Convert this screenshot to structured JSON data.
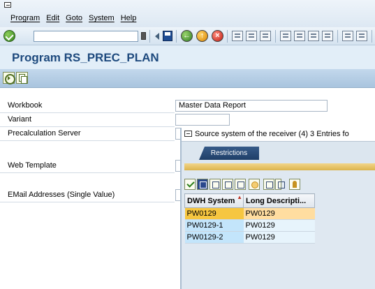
{
  "menu": [
    "Program",
    "Edit",
    "Goto",
    "System",
    "Help"
  ],
  "toolbar": {
    "command_field_value": "",
    "icons": [
      "enter-icon",
      "back-icon",
      "save-icon",
      "back-circle-icon",
      "exit-icon",
      "cancel-icon",
      "print-icon",
      "find-icon",
      "find-next-icon",
      "first-page-icon",
      "previous-page-icon",
      "next-page-icon",
      "last-page-icon"
    ]
  },
  "title": "Program RS_PREC_PLAN",
  "app_toolbar": {
    "icons": [
      "execute-icon",
      "get-variant-icon"
    ]
  },
  "form": {
    "fields": [
      {
        "label": "Workbook",
        "value": "Master Data Report"
      },
      {
        "label": "Variant",
        "value": ""
      },
      {
        "label": "Precalculation Server",
        "value": ""
      },
      {
        "label": "Web Template",
        "value": ""
      },
      {
        "label": "EMail Addresses (Single Value)",
        "value": ""
      }
    ]
  },
  "popup": {
    "title": "Source system of the receiver (4)   3 Entries fo",
    "tab": "Restrictions",
    "toolbar_icons": [
      "accept-icon",
      "cancel-icon",
      "find-icon",
      "find-next-icon",
      "filter-icon",
      "info-icon",
      "print-icon",
      "dropdown-icon",
      "personal-list-icon"
    ],
    "columns": [
      "DWH System",
      "Long Descripti..."
    ],
    "rows": [
      {
        "system": "PW0129",
        "description": "PW0129"
      },
      {
        "system": "PW0129-1",
        "description": "PW0129"
      },
      {
        "system": "PW0129-2",
        "description": "PW0129"
      }
    ]
  }
}
